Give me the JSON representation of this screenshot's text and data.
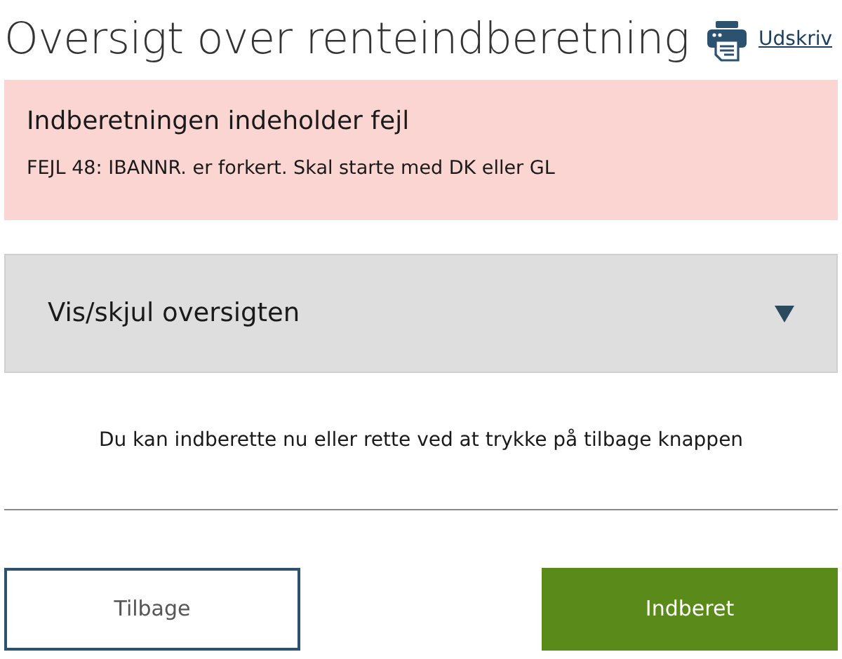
{
  "header": {
    "title": "Oversigt over renteindberetning",
    "print_link": "Udskriv"
  },
  "error_alert": {
    "heading": "Indberetningen indeholder fejl",
    "message": "FEJL 48: IBANNR. er forkert. Skal starte med DK eller GL"
  },
  "accordion": {
    "label": "Vis/skjul oversigten",
    "expanded": false
  },
  "info_text": "Du kan indberette nu eller rette ved at trykke på tilbage knappen",
  "buttons": [
    {
      "label": "Tilbage",
      "kind": "secondary"
    },
    {
      "label": "Indberet",
      "kind": "primary"
    }
  ]
}
